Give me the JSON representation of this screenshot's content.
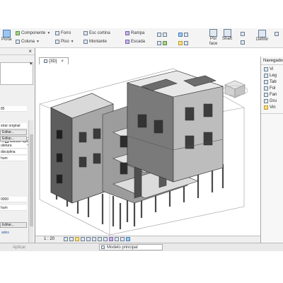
{
  "ribbon": {
    "porta": "Porta",
    "componente": "Componente",
    "coluna": "Coluna",
    "forro": "Forro",
    "piso": "Piso",
    "esc_cortina": "Esc cortina",
    "montante": "Montante",
    "rampa": "Rampa",
    "escada": "Escada",
    "por": "Por",
    "face": "face",
    "shaft": "Shaft",
    "definir": "Definir"
  },
  "left_panel": {
    "edit_type": "Editar tipo",
    "field_value": "85",
    "rows": [
      "strar original",
      "Editar...",
      "Editar...",
      "utetura",
      "disciplina",
      "hum"
    ],
    "rows2": [
      "0000",
      "hum"
    ],
    "bottom_btn": "Editar...",
    "aplicar": "Aplicar",
    "proprieties_link": "ades"
  },
  "view": {
    "tab_label": "{3D}",
    "scale": "1 : 20",
    "model_selector": "Modelo principal"
  },
  "right_panel": {
    "title": "Navegador",
    "items": [
      {
        "label": "Vi",
        "icon": "views-icon"
      },
      {
        "label": "Leg",
        "icon": "legend-icon"
      },
      {
        "label": "Tab",
        "icon": "table-icon"
      },
      {
        "label": "Fol",
        "icon": "sheet-icon"
      },
      {
        "label": "Fan",
        "icon": "family-icon"
      },
      {
        "label": "Gru",
        "icon": "group-icon"
      },
      {
        "label": "Vin",
        "icon": "link-icon"
      }
    ]
  }
}
